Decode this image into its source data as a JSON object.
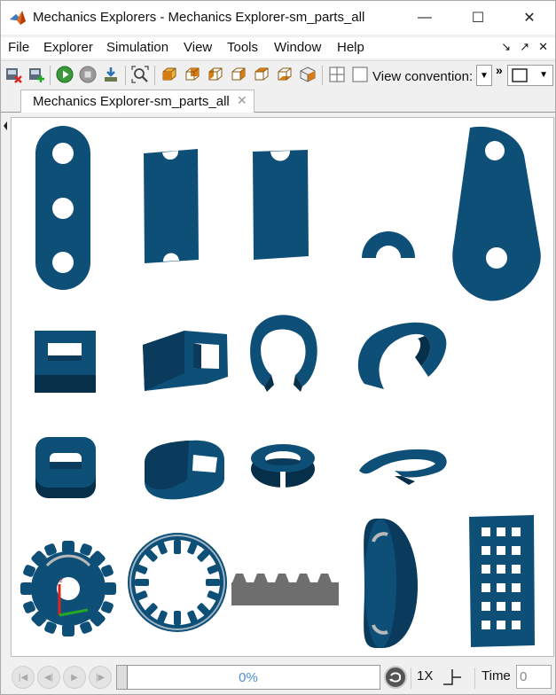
{
  "window": {
    "title": "Mechanics Explorers - Mechanics Explorer-sm_parts_all",
    "controls": {
      "minimize": "—",
      "maximize": "☐",
      "close": "✕"
    }
  },
  "menubar": {
    "items": [
      "File",
      "Explorer",
      "Simulation",
      "View",
      "Tools",
      "Window",
      "Help"
    ],
    "right_icons": [
      "↘",
      "↗",
      "✕"
    ]
  },
  "toolbar": {
    "view_convention_label": "View convention:",
    "more_label": "»",
    "icons": [
      "close-model-icon",
      "open-model-icon",
      "run-icon",
      "stop-icon",
      "import-icon",
      "zoom-fit-icon",
      "view-front-icon",
      "view-back-icon",
      "view-left-icon",
      "view-right-icon",
      "view-top-icon",
      "view-iso-icon",
      "layout-grid-icon",
      "layout-single-icon"
    ]
  },
  "tab": {
    "label": "Mechanics Explorer-sm_parts_all",
    "close": "✕"
  },
  "colors": {
    "part_blue": "#0e4f78",
    "part_dark": "#0a3b5c",
    "rack_gray": "#6e6e6e",
    "progress_text": "#4a8fd6"
  },
  "playback": {
    "progress_text": "0%",
    "progress_fraction": 0,
    "speed_label": "1X",
    "time_label": "Time",
    "time_value": "0"
  }
}
